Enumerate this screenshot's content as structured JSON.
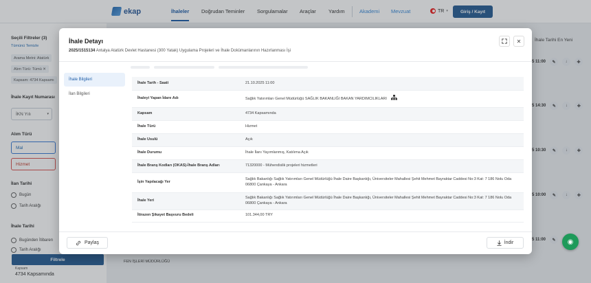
{
  "topnav": {
    "logo_text": "ekap",
    "items": [
      {
        "label": "İhaleler",
        "active": true
      },
      {
        "label": "Doğrudan Teminler"
      },
      {
        "label": "Sorgulamalar"
      },
      {
        "label": "Araçlar"
      },
      {
        "label": "Yardım"
      }
    ],
    "links": [
      {
        "label": "Akademi"
      },
      {
        "label": "Mevzuat"
      }
    ],
    "lang": "TR",
    "login_label": "Giriş / Kayıt"
  },
  "background_filters": {
    "selected_title": "Seçili Filtreler (3)",
    "clear_all": "Tümünü Temizle",
    "chips": [
      "Arama Metni: Atatürk",
      "Alım Türü: Tümü ✕",
      "Kapsam: 4734 Kapsamı"
    ],
    "kayit_label": "İhale Kayıt Numarası",
    "ikn_placeholder": "İKN Yılı",
    "alim_turu_label": "Alım Türü",
    "mal": "Mal",
    "hizmet": "Hizmet",
    "ilan_tarihi_label": "İlan Tarihi",
    "ilan_options": [
      "Bugün",
      "Tarih Aralığı"
    ],
    "ihale_tarihi_label": "İhale Tarihi",
    "ihale_options": [
      "Bugünden İtibaren",
      "Tarih Aralığı"
    ],
    "filter_button": "Filtrele",
    "kapsam_label": "Kapsam",
    "kapsam_value": "4734 Kapsamında"
  },
  "background_list": {
    "sort_label": "İhale Tarihi En Yeni",
    "times": [
      "5 11:00",
      "5 14:30",
      "5 10:30",
      "5 10:00",
      "5 11:00"
    ],
    "company_text": "FEN İŞLERİ MÜDÜRLÜĞÜ"
  },
  "modal": {
    "title": "İhale Detayı",
    "ikn": "2025/1515134",
    "subtitle": "Antalya Atatürk Devlet Hastanesi (300 Yatak) Uygulama Projeleri ve İhale Dokümanlarının Hazırlanması İşi",
    "tabs": [
      {
        "label": "İhale Bilgileri",
        "active": true
      },
      {
        "label": "İlan Bilgileri"
      }
    ],
    "rows": [
      {
        "key": "İhale Tarih - Saati",
        "value": "21.10.2025 11:00"
      },
      {
        "key": "İhaleyi Yapan İdare Adı",
        "value": "Sağlık Yatırımları Genel Müdürlüğü SAĞLIK BAKANLIĞI BAKAN YARDIMCILIKLARI"
      },
      {
        "key": "Kapsam",
        "value": "4734 Kapsamında"
      },
      {
        "key": "İhale Türü",
        "value": "Hizmet"
      },
      {
        "key": "İhale Usulü",
        "value": "Açık"
      },
      {
        "key": "İhale Durumu",
        "value": "İhale İlanı Yayımlanmış, Katılıma Açık"
      },
      {
        "key": "İhale Branş Kodları (OKAS)-İhale Branş Adları",
        "value": "71320000 - Mühendislik projeleri hizmetleri"
      },
      {
        "key": "İşin Yapılacağı Yer",
        "value": "Sağlık Bakanlığı Sağlık Yatırımları Genel Müdürlüğü İhale Daire Başkanlığı, Üniversiteler Mahallesi Şehit Mehmet Bayraktar Caddesi No:3 Kat: 7 186 Nolu Oda 06800 Çankaya - Ankara"
      },
      {
        "key": "İhale Yeri",
        "value": "Sağlık Bakanlığı Sağlık Yatırımları Genel Müdürlüğü İhale Daire Başkanlığı, Üniversiteler Mahallesi Şehit Mehmet Bayraktar Caddesi No:3 Kat: 7 186 Nolu Oda 06800 Çankaya - Ankara"
      },
      {
        "key": "İtirazen Şikayet Başvuru Bedeli",
        "value": "101.344,00 TRY"
      }
    ],
    "share_label": "Paylaş",
    "download_label": "İndir"
  }
}
